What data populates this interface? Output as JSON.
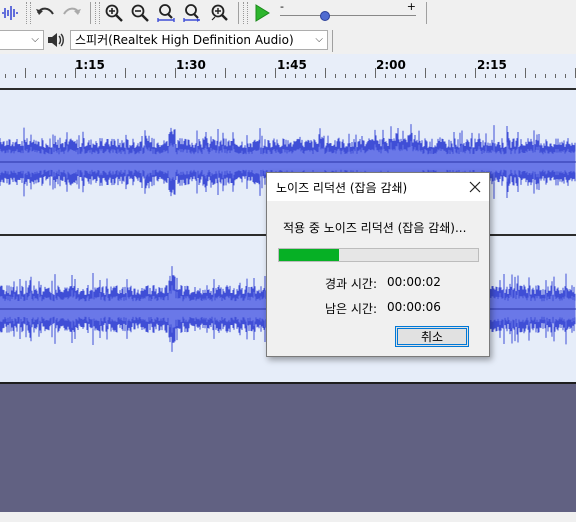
{
  "toolbar": {
    "slider": {
      "minus": "-",
      "plus": "+",
      "level": 0.33
    }
  },
  "device_bar": {
    "left_combo_value": "",
    "output_device": "스피커(Realtek High Definition Audio)"
  },
  "timeline": {
    "ticks": [
      "1:15",
      "1:30",
      "1:45",
      "2:00",
      "2:15"
    ]
  },
  "colors": {
    "waveform": "#3f4ed6",
    "waveform_core": "#6a78e8",
    "track_bg": "#e6edf9",
    "progress": "#06b025"
  },
  "dialog": {
    "title": "노이즈 리덕션 (잡음 감쇄)",
    "message": "적용 중 노이즈 리덕션 (잡음 감쇄)...",
    "progress": 0.3,
    "elapsed_label": "경과 시간:",
    "elapsed_value": "00:00:02",
    "remaining_label": "남은 시간:",
    "remaining_value": "00:00:06",
    "cancel_label": "취소"
  }
}
